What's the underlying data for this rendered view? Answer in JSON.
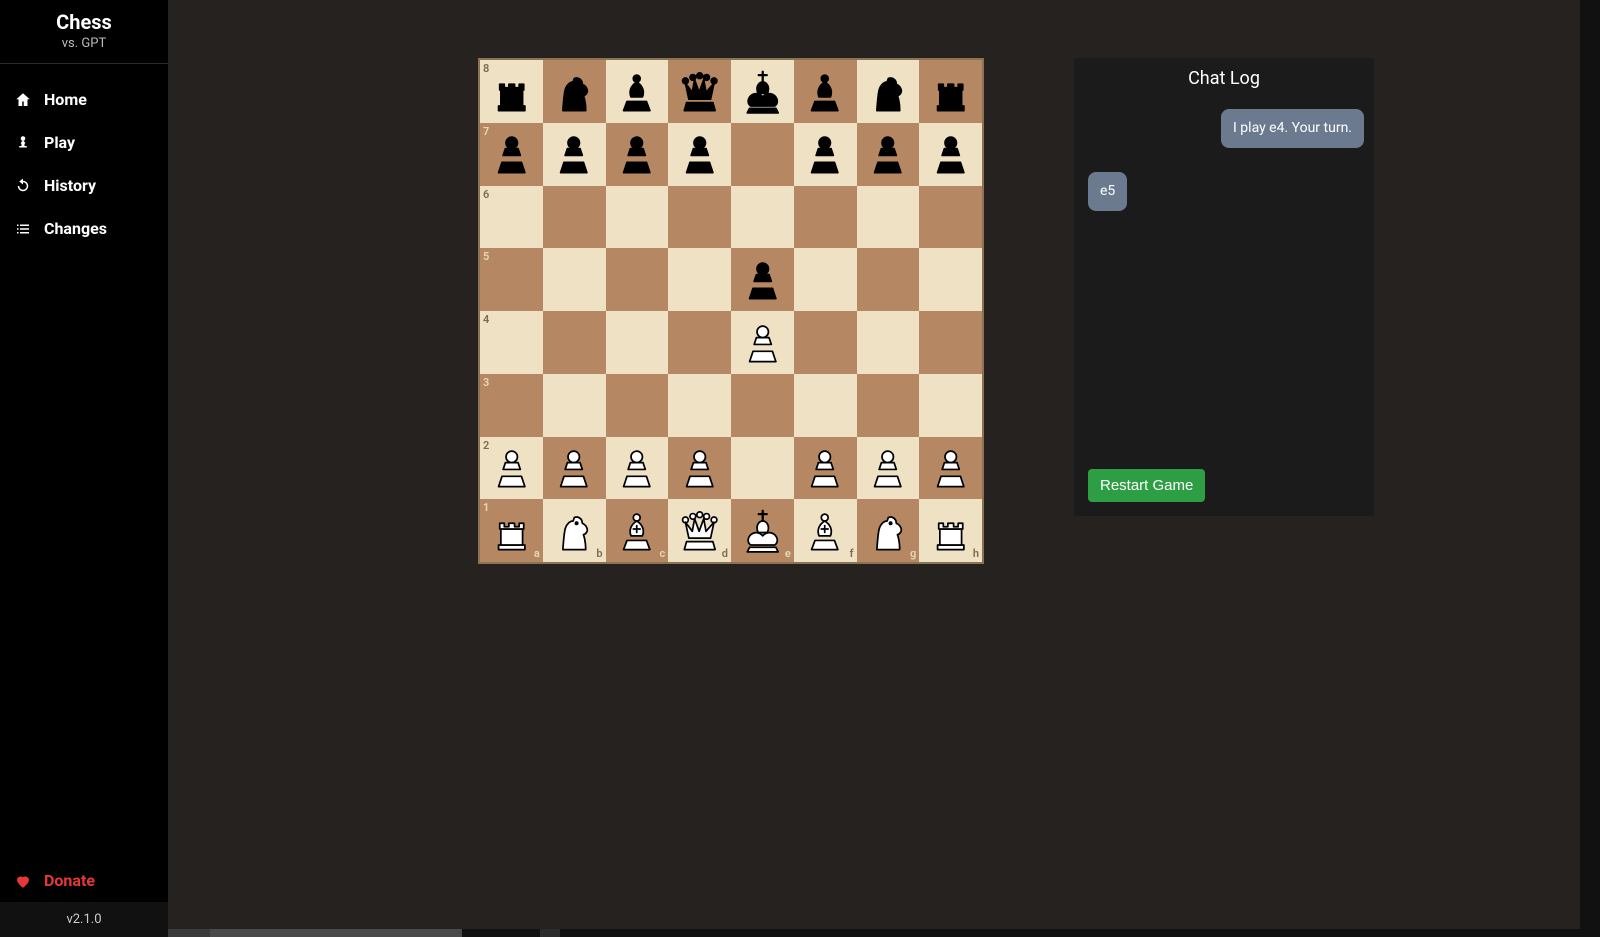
{
  "app": {
    "title": "Chess",
    "subtitle": "vs. GPT",
    "version": "v2.1.0"
  },
  "nav": {
    "home": "Home",
    "play": "Play",
    "history": "History",
    "changes": "Changes",
    "donate": "Donate"
  },
  "chat": {
    "title": "Chat Log",
    "messages": [
      {
        "side": "right",
        "text": "I play e4. Your turn."
      },
      {
        "side": "left",
        "text": "e5"
      }
    ],
    "restart_label": "Restart Game"
  },
  "board": {
    "light_color": "#efe1c3",
    "dark_color": "#b58863",
    "ranks": [
      "8",
      "7",
      "6",
      "5",
      "4",
      "3",
      "2",
      "1"
    ],
    "files": [
      "a",
      "b",
      "c",
      "d",
      "e",
      "f",
      "g",
      "h"
    ],
    "position": {
      "a8": "r",
      "b8": "n",
      "c8": "b",
      "d8": "q",
      "e8": "k",
      "f8": "b",
      "g8": "n",
      "h8": "r",
      "a7": "p",
      "b7": "p",
      "c7": "p",
      "d7": "p",
      "f7": "p",
      "g7": "p",
      "h7": "p",
      "e5": "p",
      "e4": "P",
      "a2": "P",
      "b2": "P",
      "c2": "P",
      "d2": "P",
      "f2": "P",
      "g2": "P",
      "h2": "P",
      "a1": "R",
      "b1": "N",
      "c1": "B",
      "d1": "Q",
      "e1": "K",
      "f1": "B",
      "g1": "N",
      "h1": "R"
    }
  }
}
